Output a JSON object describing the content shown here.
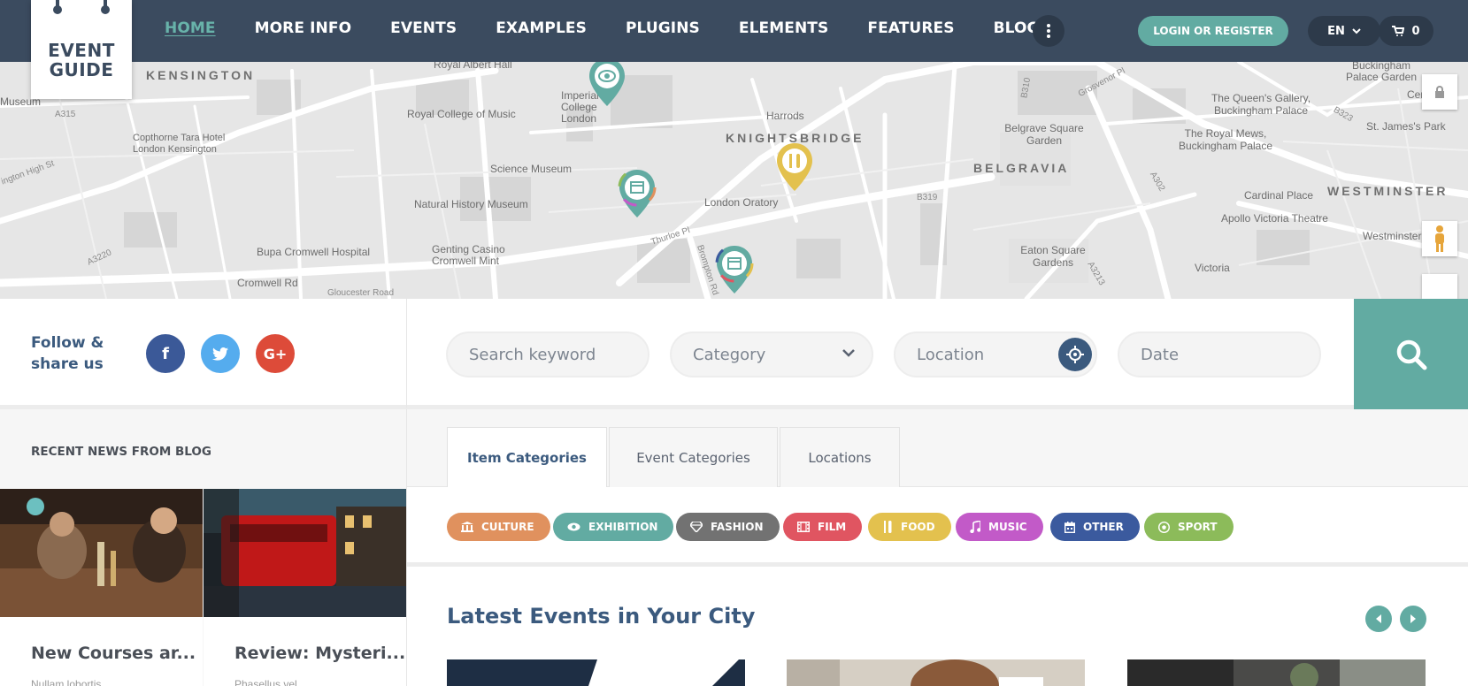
{
  "header": {
    "logo_line1": "EVENT",
    "logo_line2": "GUIDE",
    "nav": [
      "HOME",
      "MORE INFO",
      "EVENTS",
      "EXAMPLES",
      "PLUGINS",
      "ELEMENTS",
      "FEATURES",
      "BLOG"
    ],
    "more_icon": "vertical-dots-icon",
    "login_label": "LOGIN OR REGISTER",
    "language": "EN",
    "cart_count": "0"
  },
  "map": {
    "labels": {
      "kensington": "KENSINGTON",
      "knightsbridge": "KNIGHTSBRIDGE",
      "belgravia": "BELGRAVIA",
      "westminster": "WESTMINSTER",
      "royal_albert_hall": "Royal Albert Hall",
      "royal_college_music": "Royal College of Music",
      "imperial_college": "Imperial College London",
      "science_museum": "Science Museum",
      "natural_history_museum": "Natural History Museum",
      "london_oratory": "London Oratory",
      "harrods": "Harrods",
      "copthorne": "Copthorne Tara Hotel London Kensington",
      "bupa": "Bupa Cromwell Hospital",
      "genting": "Genting Casino Cromwell Mint",
      "cromwell_rd": "Cromwell Rd",
      "gloucester_rd": "Gloucester Road",
      "thurloe_pl": "Thurloe Pl",
      "brompton_rd": "Brompton Rd",
      "belgrave_square": "Belgrave Square Garden",
      "eaton_square": "Eaton Square Gardens",
      "victoria": "Victoria",
      "apollo": "Apollo Victoria Theatre",
      "cardinal_place": "Cardinal Place",
      "westminster_cathedral": "Westminster Cathe",
      "buckingham_garden": "Buckingham Palace Garden",
      "queens_gallery": "The Queen's Gallery, Buckingham Palace",
      "royal_mews": "The Royal Mews, Buckingham Palace",
      "st_james_park": "St. James's Park",
      "central_h": "Central H",
      "grosvenor": "Grosvenor Pl",
      "museum": "Museum",
      "kensington_high_st": "ington High St",
      "a315": "A315",
      "a3220": "A3220",
      "a302": "A302",
      "b319": "B319",
      "b310": "B310",
      "b323": "B323",
      "a3213": "A3213"
    }
  },
  "follow": {
    "text_line1": "Follow &",
    "text_line2": "share us",
    "facebook_label": "f",
    "twitter_icon": "twitter-icon",
    "google_label": "G+"
  },
  "search": {
    "keyword_placeholder": "Search keyword",
    "category_label": "Category",
    "location_placeholder": "Location",
    "date_placeholder": "Date"
  },
  "blog": {
    "title": "RECENT NEWS FROM BLOG",
    "posts": [
      {
        "title": "New Courses ar...",
        "excerpt": "Nullam lobortis..."
      },
      {
        "title": "Review: Mysteri...",
        "excerpt": "Phasellus vel..."
      }
    ]
  },
  "tabs": [
    "Item Categories",
    "Event Categories",
    "Locations"
  ],
  "categories": [
    {
      "label": "CULTURE",
      "color": "#e0915e",
      "icon": "bank-icon"
    },
    {
      "label": "EXHIBITION",
      "color": "#62aba2",
      "icon": "eye-icon"
    },
    {
      "label": "FASHION",
      "color": "#727272",
      "icon": "diamond-icon"
    },
    {
      "label": "FILM",
      "color": "#e05561",
      "icon": "film-icon"
    },
    {
      "label": "FOOD",
      "color": "#e3c14e",
      "icon": "fork-knife-icon"
    },
    {
      "label": "MUSIC",
      "color": "#c25ac8",
      "icon": "music-note-icon"
    },
    {
      "label": "OTHER",
      "color": "#3b5a9e",
      "icon": "calendar-icon"
    },
    {
      "label": "SPORT",
      "color": "#8cbb5a",
      "icon": "ball-icon"
    }
  ],
  "latest": {
    "title": "Latest Events in Your City"
  },
  "colors": {
    "header_bg": "#3b4b5f",
    "accent": "#62aba2",
    "title_blue": "#3b5a7e"
  }
}
